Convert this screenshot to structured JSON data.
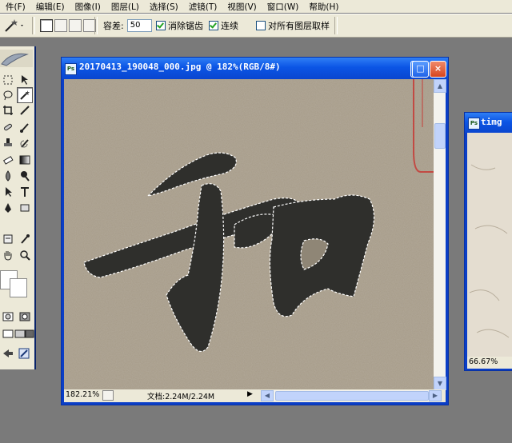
{
  "menubar": {
    "items": [
      {
        "label": "件(F)"
      },
      {
        "label": "编辑(E)"
      },
      {
        "label": "图像(I)"
      },
      {
        "label": "图层(L)"
      },
      {
        "label": "选择(S)"
      },
      {
        "label": "滤镜(T)"
      },
      {
        "label": "视图(V)"
      },
      {
        "label": "窗口(W)"
      },
      {
        "label": "帮助(H)"
      }
    ]
  },
  "options": {
    "tolerance_label": "容差:",
    "tolerance_value": "50",
    "anti_alias_label": "消除锯齿",
    "anti_alias_checked": true,
    "contiguous_label": "连续",
    "contiguous_checked": true,
    "sample_all_label": "对所有图层取样",
    "sample_all_checked": false
  },
  "document": {
    "title": "20170413_190048_000.jpg @ 182%(RGB/8#)",
    "zoom": "182.21%",
    "doc_info": "文档:2.24M/2.24M",
    "buttons": {
      "minimize": "_",
      "maximize": "□",
      "close": "×"
    }
  },
  "second_window": {
    "title": "timg",
    "zoom": "66.67%"
  },
  "colors": {
    "titlebar": "#0b55e5",
    "paper": "#a49986",
    "ink": "#2f2f2c",
    "seal_red": "#c8332f"
  }
}
